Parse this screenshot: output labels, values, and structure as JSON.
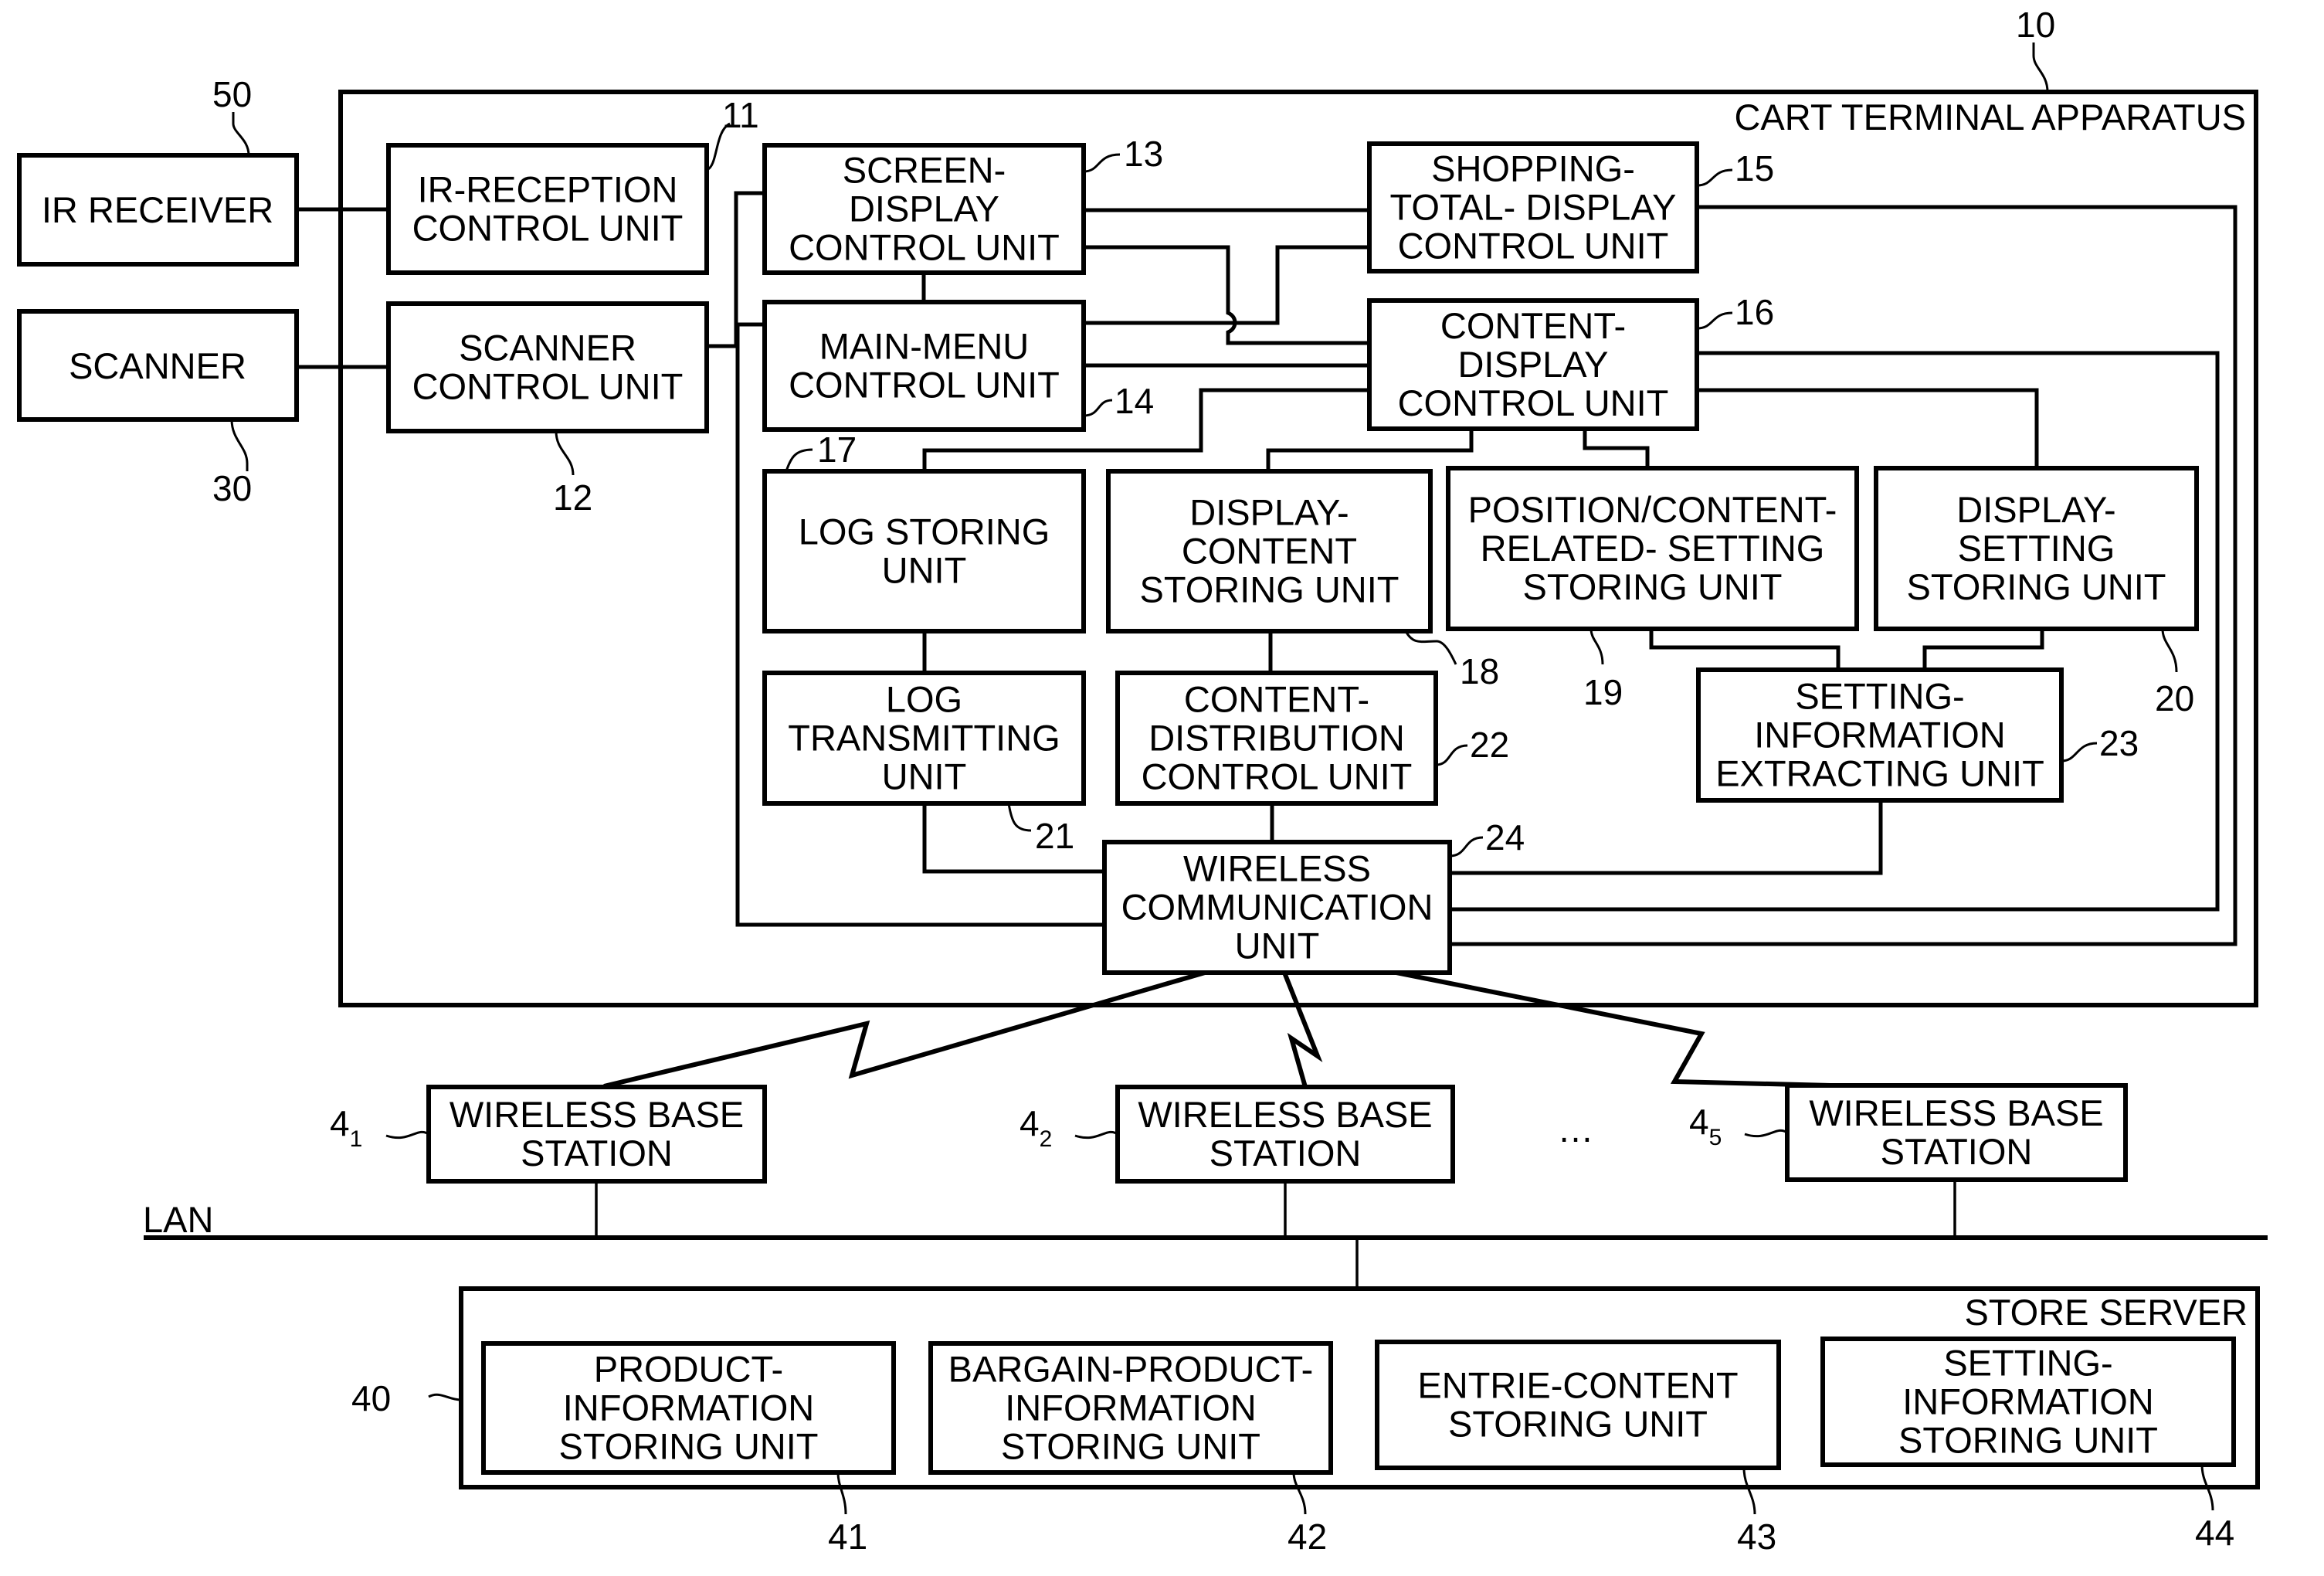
{
  "figure": {
    "cart_terminal": {
      "title": "CART TERMINAL APPARATUS",
      "ref": "10"
    },
    "external": {
      "ir_receiver": {
        "lines": [
          "IR RECEIVER"
        ],
        "ref": "50"
      },
      "scanner": {
        "lines": [
          "SCANNER"
        ],
        "ref": "30"
      }
    },
    "units": {
      "ir_reception_control": {
        "lines": [
          "IR-RECEPTION",
          "CONTROL UNIT"
        ],
        "ref": "11"
      },
      "scanner_control": {
        "lines": [
          "SCANNER",
          "CONTROL UNIT"
        ],
        "ref": "12"
      },
      "screen_display_control": {
        "lines": [
          "SCREEN-",
          "DISPLAY",
          "CONTROL UNIT"
        ],
        "ref": "13"
      },
      "main_menu_control": {
        "lines": [
          "MAIN-MENU",
          "CONTROL UNIT"
        ],
        "ref": "14"
      },
      "shopping_total_display_control": {
        "lines": [
          "SHOPPING-",
          "TOTAL- DISPLAY",
          "CONTROL UNIT"
        ],
        "ref": "15"
      },
      "content_display_control": {
        "lines": [
          "CONTENT-",
          "DISPLAY",
          "CONTROL UNIT"
        ],
        "ref": "16"
      },
      "log_storing": {
        "lines": [
          "LOG STORING",
          "UNIT"
        ],
        "ref": "17"
      },
      "display_content_storing": {
        "lines": [
          "DISPLAY-",
          "CONTENT",
          "STORING UNIT"
        ],
        "ref": "18"
      },
      "position_content_related_setting_storing": {
        "lines": [
          "POSITION/CONTENT-",
          "RELATED- SETTING",
          "STORING UNIT"
        ],
        "ref": "19"
      },
      "display_setting_storing": {
        "lines": [
          "DISPLAY-",
          "SETTING",
          "STORING UNIT"
        ],
        "ref": "20"
      },
      "log_transmitting": {
        "lines": [
          "LOG",
          "TRANSMITTING",
          "UNIT"
        ],
        "ref": "21"
      },
      "content_distribution_control": {
        "lines": [
          "CONTENT-",
          "DISTRIBUTION",
          "CONTROL UNIT"
        ],
        "ref": "22"
      },
      "setting_information_extracting": {
        "lines": [
          "SETTING-",
          "INFORMATION",
          "EXTRACTING UNIT"
        ],
        "ref": "23"
      },
      "wireless_communication": {
        "lines": [
          "WIRELESS",
          "COMMUNICATION",
          "UNIT"
        ],
        "ref": "24"
      }
    },
    "base_stations": [
      {
        "lines": [
          "WIRELESS BASE",
          "STATION"
        ],
        "ref": "4",
        "sub": "1"
      },
      {
        "lines": [
          "WIRELESS BASE",
          "STATION"
        ],
        "ref": "4",
        "sub": "2"
      },
      {
        "lines": [
          "WIRELESS BASE",
          "STATION"
        ],
        "ref": "4",
        "sub": "5"
      }
    ],
    "ellipsis": "…",
    "lan_label": "LAN",
    "store_server": {
      "title": "STORE SERVER",
      "ref": "40",
      "units": [
        {
          "lines": [
            "PRODUCT-",
            "INFORMATION",
            "STORING UNIT"
          ],
          "ref": "41"
        },
        {
          "lines": [
            "BARGAIN-PRODUCT-",
            "INFORMATION",
            "STORING UNIT"
          ],
          "ref": "42"
        },
        {
          "lines": [
            "ENTRIE-CONTENT",
            "STORING UNIT"
          ],
          "ref": "43"
        },
        {
          "lines": [
            "SETTING-",
            "INFORMATION",
            "STORING UNIT"
          ],
          "ref": "44"
        }
      ]
    }
  }
}
